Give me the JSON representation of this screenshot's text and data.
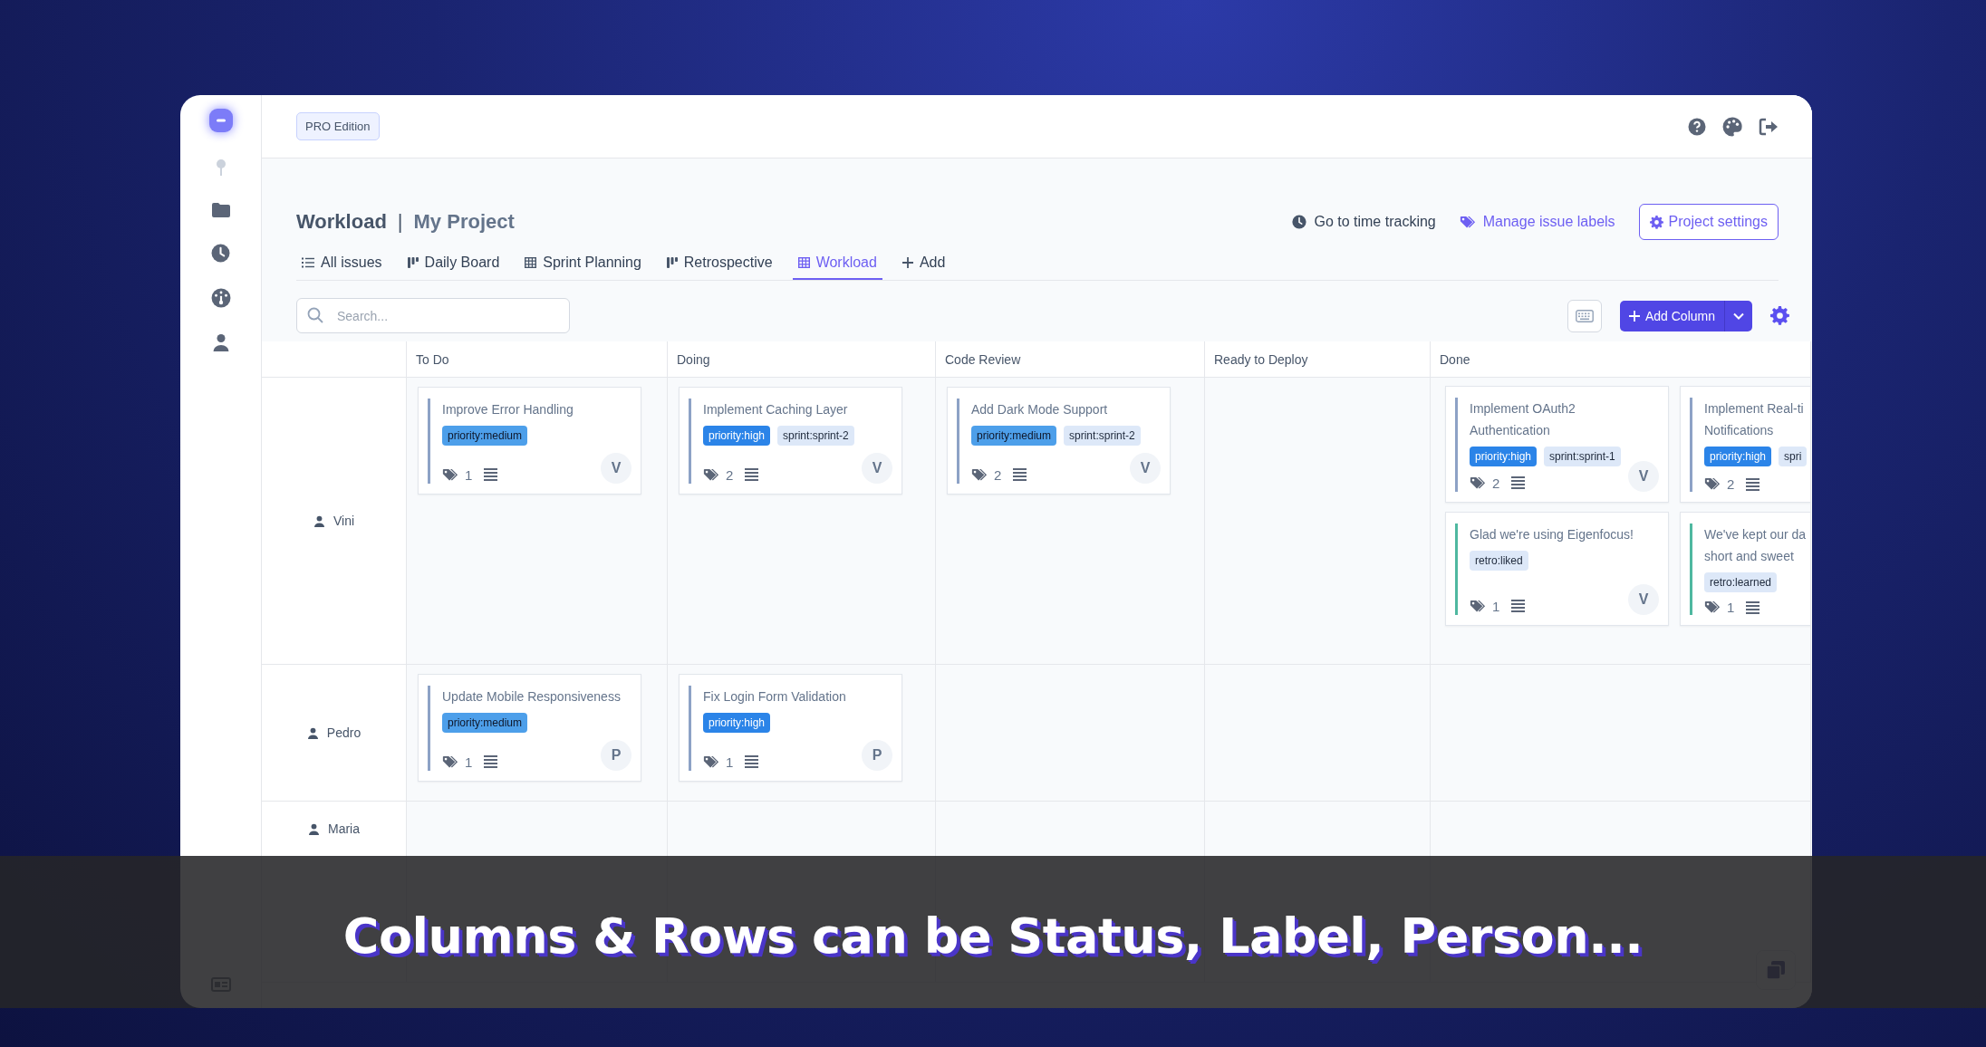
{
  "edition_badge": "PRO Edition",
  "page_title": "Workload",
  "title_separator": "|",
  "project_name": "My Project",
  "header_actions": [
    {
      "label": "Go to time tracking",
      "kind": "link"
    },
    {
      "label": "Manage issue labels",
      "kind": "accent-link"
    },
    {
      "label": "Project settings",
      "kind": "outline-button"
    }
  ],
  "tabs": [
    {
      "label": "All issues",
      "kind": "list",
      "selected": false
    },
    {
      "label": "Daily Board",
      "kind": "board",
      "selected": false
    },
    {
      "label": "Sprint Planning",
      "kind": "table",
      "selected": false
    },
    {
      "label": "Retrospective",
      "kind": "board",
      "selected": false
    },
    {
      "label": "Workload",
      "kind": "table",
      "selected": true
    },
    {
      "label": "Add",
      "kind": "add",
      "selected": false
    }
  ],
  "search": {
    "placeholder": "Search..."
  },
  "add_column_button": "Add Column",
  "board": {
    "columns": [
      "To Do",
      "Doing",
      "Code Review",
      "Ready to Deploy",
      "Done"
    ],
    "rows": [
      {
        "person": "Vini",
        "cells": [
          [
            {
              "title": "Improve Error Handling",
              "color": "#8da2c6",
              "tags": [
                {
                  "text": "priority:medium",
                  "kind": "medium"
                }
              ],
              "tag_count": "1",
              "avatar": "V"
            }
          ],
          [
            {
              "title": "Implement Caching Layer",
              "color": "#8da2c6",
              "tags": [
                {
                  "text": "priority:high",
                  "kind": "high"
                },
                {
                  "text": "sprint:sprint-2",
                  "kind": "plain"
                }
              ],
              "tag_count": "2",
              "avatar": "V"
            }
          ],
          [
            {
              "title": "Add Dark Mode Support",
              "color": "#8da2c6",
              "tags": [
                {
                  "text": "priority:medium",
                  "kind": "medium"
                },
                {
                  "text": "sprint:sprint-2",
                  "kind": "plain"
                }
              ],
              "tag_count": "2",
              "avatar": "V"
            }
          ],
          [],
          [
            {
              "title": "Implement OAuth2\nAuthentication",
              "color": "#8da2c6",
              "tags": [
                {
                  "text": "priority:high",
                  "kind": "high"
                },
                {
                  "text": "sprint:sprint-1",
                  "kind": "plain"
                }
              ],
              "tag_count": "2",
              "avatar": "V"
            },
            {
              "title": "Implement Real-ti\nNotifications",
              "color": "#8da2c6",
              "tags": [
                {
                  "text": "priority:high",
                  "kind": "high"
                },
                {
                  "text": "spri",
                  "kind": "plain"
                }
              ],
              "tag_count": "2"
            },
            {
              "title": "Glad we're using Eigenfocus!",
              "color": "#4fb8a0",
              "tags": [
                {
                  "text": "retro:liked",
                  "kind": "plain"
                }
              ],
              "tag_count": "1",
              "avatar": "V"
            },
            {
              "title": "We've kept our da\nshort and sweet",
              "color": "#4fb8a0",
              "tags": [
                {
                  "text": "retro:learned",
                  "kind": "plain"
                }
              ],
              "tag_count": "1"
            }
          ]
        ]
      },
      {
        "person": "Pedro",
        "cells": [
          [
            {
              "title": "Update Mobile Responsiveness",
              "color": "#8da2c6",
              "tags": [
                {
                  "text": "priority:medium",
                  "kind": "medium"
                }
              ],
              "tag_count": "1",
              "avatar": "P"
            }
          ],
          [
            {
              "title": "Fix Login Form Validation",
              "color": "#8da2c6",
              "tags": [
                {
                  "text": "priority:high",
                  "kind": "high"
                }
              ],
              "tag_count": "1",
              "avatar": "P"
            }
          ],
          [],
          [],
          []
        ]
      },
      {
        "person": "Maria",
        "cells": [
          [],
          [],
          [],
          [],
          []
        ]
      }
    ]
  },
  "caption": "Columns & Rows can be Status, Label, Person..."
}
